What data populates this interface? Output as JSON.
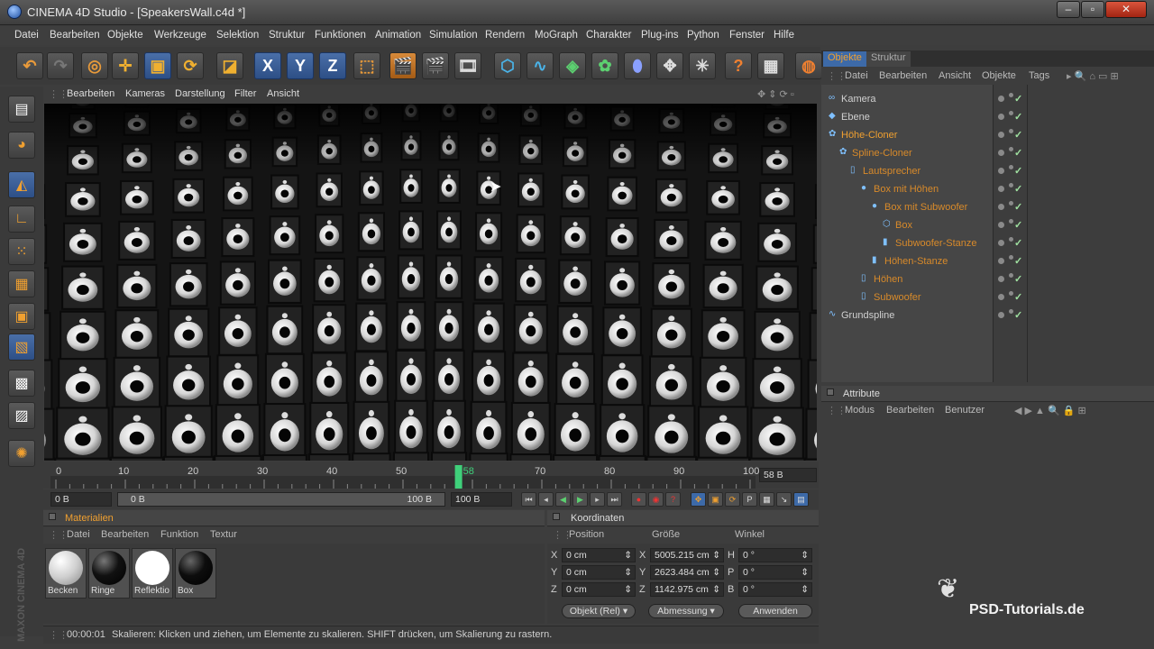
{
  "window": {
    "title": "CINEMA 4D Studio - [SpeakersWall.c4d *]"
  },
  "menu": [
    "Datei",
    "Bearbeiten",
    "Objekte",
    "Werkzeuge",
    "Selektion",
    "Struktur",
    "Funktionen",
    "Animation",
    "Simulation",
    "Rendern",
    "MoGraph",
    "Charakter",
    "Plug-ins",
    "Python",
    "Fenster",
    "Hilfe"
  ],
  "toolbar": {
    "axis_x": "X",
    "axis_y": "Y",
    "axis_z": "Z"
  },
  "viewport_menu": [
    "Bearbeiten",
    "Kameras",
    "Darstellung",
    "Filter",
    "Ansicht"
  ],
  "timeline": {
    "ticks": [
      "0",
      "10",
      "20",
      "30",
      "40",
      "50",
      "58",
      "70",
      "80",
      "90",
      "100"
    ],
    "current_frame": 58,
    "current_label": "58",
    "frame_field": "58 B",
    "start_field": "0 B",
    "range_start": "0 B",
    "range_end": "100 B",
    "end_field": "100 B"
  },
  "materials": {
    "title": "Materialien",
    "menu": [
      "Datei",
      "Bearbeiten",
      "Funktion",
      "Textur"
    ],
    "items": [
      {
        "name": "Becken",
        "color": "#e8e8e8"
      },
      {
        "name": "Ringe",
        "color": "#101010"
      },
      {
        "name": "Reflektio",
        "color": "#ffffff"
      },
      {
        "name": "Box",
        "color": "#0d0d0d"
      }
    ]
  },
  "coordinates": {
    "title": "Koordinaten",
    "headers": [
      "Position",
      "Größe",
      "Winkel"
    ],
    "rows": [
      {
        "pos_label": "X",
        "pos": "0 cm",
        "size_label": "X",
        "size": "5005.215 cm",
        "rot_label": "H",
        "rot": "0 °"
      },
      {
        "pos_label": "Y",
        "pos": "0 cm",
        "size_label": "Y",
        "size": "2623.484 cm",
        "rot_label": "P",
        "rot": "0 °"
      },
      {
        "pos_label": "Z",
        "pos": "0 cm",
        "size_label": "Z",
        "size": "1142.975 cm",
        "rot_label": "B",
        "rot": "0 °"
      }
    ],
    "mode_dropdown": "Objekt (Rel)",
    "size_dropdown": "Abmessung",
    "apply_button": "Anwenden"
  },
  "status": {
    "time": "00:00:01",
    "message": "Skalieren: Klicken und ziehen, um Elemente zu skalieren. SHIFT drücken, um Skalierung zu rastern."
  },
  "objects_panel": {
    "tabs": [
      "Objekte",
      "Struktur"
    ],
    "menu": [
      "Datei",
      "Bearbeiten",
      "Ansicht",
      "Objekte",
      "Tags"
    ],
    "tree": [
      {
        "name": "Kamera",
        "depth": 0,
        "color": "#d0d0d0"
      },
      {
        "name": "Ebene",
        "depth": 0,
        "color": "#d0d0d0"
      },
      {
        "name": "Höhe-Cloner",
        "depth": 0,
        "color": "#f0a030"
      },
      {
        "name": "Spline-Cloner",
        "depth": 1,
        "color": "#d88a2a"
      },
      {
        "name": "Lautsprecher",
        "depth": 2,
        "color": "#d88a2a"
      },
      {
        "name": "Box mit Höhen",
        "depth": 3,
        "color": "#d88a2a"
      },
      {
        "name": "Box mit Subwoofer",
        "depth": 4,
        "color": "#d88a2a"
      },
      {
        "name": "Box",
        "depth": 5,
        "color": "#d88a2a"
      },
      {
        "name": "Subwoofer-Stanze",
        "depth": 5,
        "color": "#d88a2a"
      },
      {
        "name": "Höhen-Stanze",
        "depth": 4,
        "color": "#d88a2a"
      },
      {
        "name": "Höhen",
        "depth": 3,
        "color": "#d88a2a"
      },
      {
        "name": "Subwoofer",
        "depth": 3,
        "color": "#d88a2a"
      },
      {
        "name": "Grundspline",
        "depth": 0,
        "color": "#d0d0d0"
      }
    ]
  },
  "attributes_panel": {
    "title": "Attribute",
    "menu": [
      "Modus",
      "Bearbeiten",
      "Benutzer"
    ]
  },
  "watermark": {
    "brand": "MAXON CINEMA 4D",
    "site": "PSD-Tutorials.de"
  },
  "colors": {
    "accent": "#f0a030",
    "selection_blue": "#3d6aa8",
    "check_green": "#9fe0a0"
  }
}
